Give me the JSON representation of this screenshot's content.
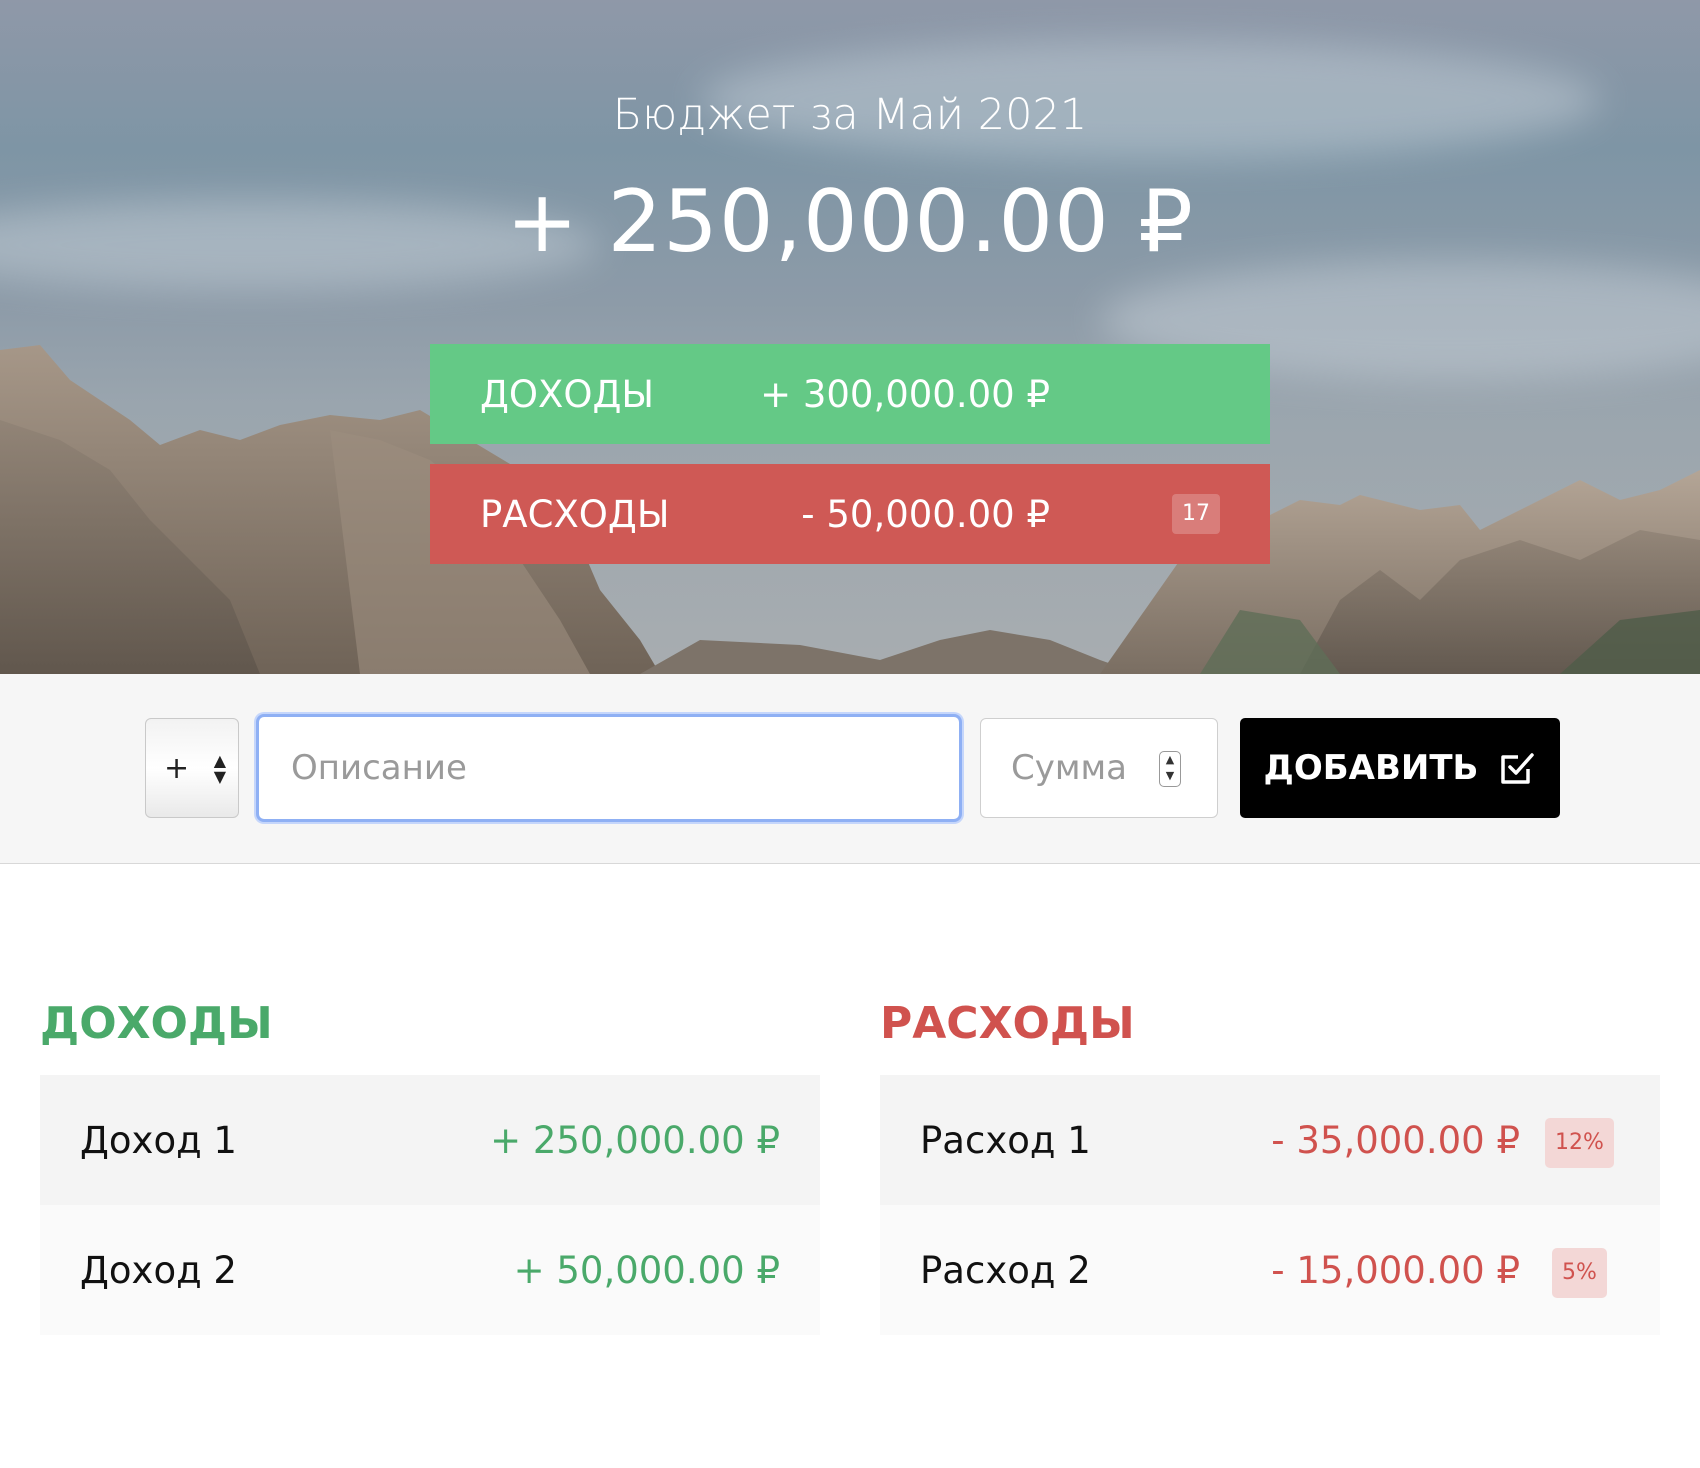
{
  "header": {
    "title": "Бюджет за Май 2021",
    "total": "+ 250,000.00 ₽"
  },
  "summary": {
    "income": {
      "label": "Доходы",
      "value": "+ 300,000.00 ₽"
    },
    "expense": {
      "label": "Расходы",
      "value": "- 50,000.00 ₽",
      "percent": "17"
    }
  },
  "add_form": {
    "type_value": "+",
    "description_placeholder": "Описание",
    "amount_placeholder": "Сумма",
    "add_label": "Добавить"
  },
  "income": {
    "title": "Доходы",
    "items": [
      {
        "description": "Доход 1",
        "value": "+ 250,000.00 ₽"
      },
      {
        "description": "Доход 2",
        "value": "+ 50,000.00 ₽"
      }
    ]
  },
  "expense": {
    "title": "Расходы",
    "items": [
      {
        "description": "Расход 1",
        "value": "- 35,000.00 ₽",
        "percent": "12%"
      },
      {
        "description": "Расход 2",
        "value": "- 15,000.00 ₽",
        "percent": "5%"
      }
    ]
  },
  "colors": {
    "income": "#64c986",
    "expense": "#cf5955",
    "income_text": "#4aa96a",
    "expense_text": "#d0524e",
    "button": "#000000",
    "focus_ring": "#8fb0f4"
  }
}
